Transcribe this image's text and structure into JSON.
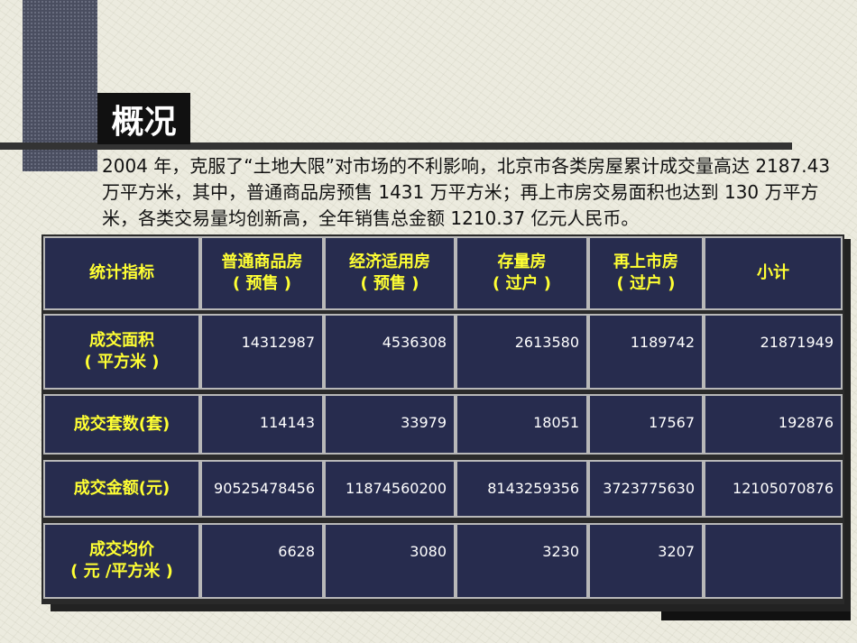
{
  "title": "概况",
  "paragraph": "2004 年，克服了“土地大限”对市场的不利影响，北京市各类房屋累计成交量高达 2187.43 万平方米，其中，普通商品房预售 1431 万平方米；再上市房交易面积也达到 130 万平方米，各类交易量均创新高，全年销售总金额 1210.37 亿元人民币。",
  "table": {
    "headers": [
      "统计指标",
      "普通商品房\n( 预售 )",
      "经济适用房\n( 预售 )",
      "存量房\n( 过户 )",
      "再上市房\n( 过户 )",
      "小计"
    ],
    "rows": [
      {
        "label": "成交面积\n( 平方米 )",
        "values": [
          "14312987",
          "4536308",
          "2613580",
          "1189742",
          "21871949"
        ]
      },
      {
        "label": "成交套数(套)",
        "values": [
          "114143",
          "33979",
          "18051",
          "17567",
          "192876"
        ]
      },
      {
        "label": "成交金额(元)",
        "values": [
          "90525478456",
          "11874560200",
          "8143259356",
          "3723775630",
          "12105070876"
        ]
      },
      {
        "label": "成交均价\n( 元 /平方米 )",
        "values": [
          "6628",
          "3080",
          "3230",
          "3207",
          ""
        ]
      }
    ]
  }
}
